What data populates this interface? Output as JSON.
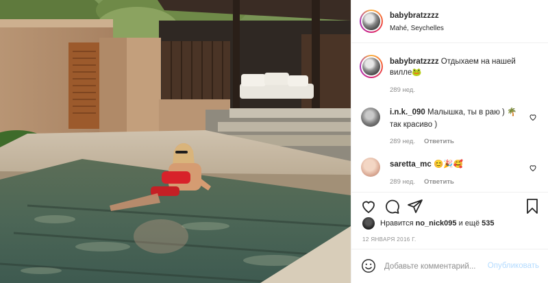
{
  "post": {
    "author": {
      "username": "babybratzzzz",
      "location": "Mahé, Seychelles"
    },
    "caption": {
      "username": "babybratzzzz",
      "text": "Отдыхаем на нашей вилле🐸",
      "time": "289 нед."
    },
    "comments": [
      {
        "username": "i.n.k._090",
        "text": "Малышка, ты в раю ) 🌴так красиво )",
        "time": "289 нед.",
        "reply_label": "Ответить"
      },
      {
        "username": "saretta_mc",
        "text": "😊🎉🥰",
        "time": "289 нед.",
        "reply_label": "Ответить"
      }
    ],
    "likes": {
      "prefix": "Нравится",
      "user": "no_nick095",
      "connector": "и ещё",
      "count": "535"
    },
    "date": "12 ЯНВАРЯ 2016 Г.",
    "add_comment": {
      "placeholder": "Добавьте комментарий...",
      "publish_label": "Опубликовать"
    },
    "icons": {
      "more": "more-icon",
      "heart": "heart-icon",
      "comment": "comment-icon",
      "share": "share-icon",
      "save": "bookmark-icon",
      "emoji": "emoji-icon"
    },
    "colors": {
      "link": "#b3dbff",
      "secondary": "#8e8e8e",
      "text": "#262626",
      "divider": "#efefef"
    }
  }
}
